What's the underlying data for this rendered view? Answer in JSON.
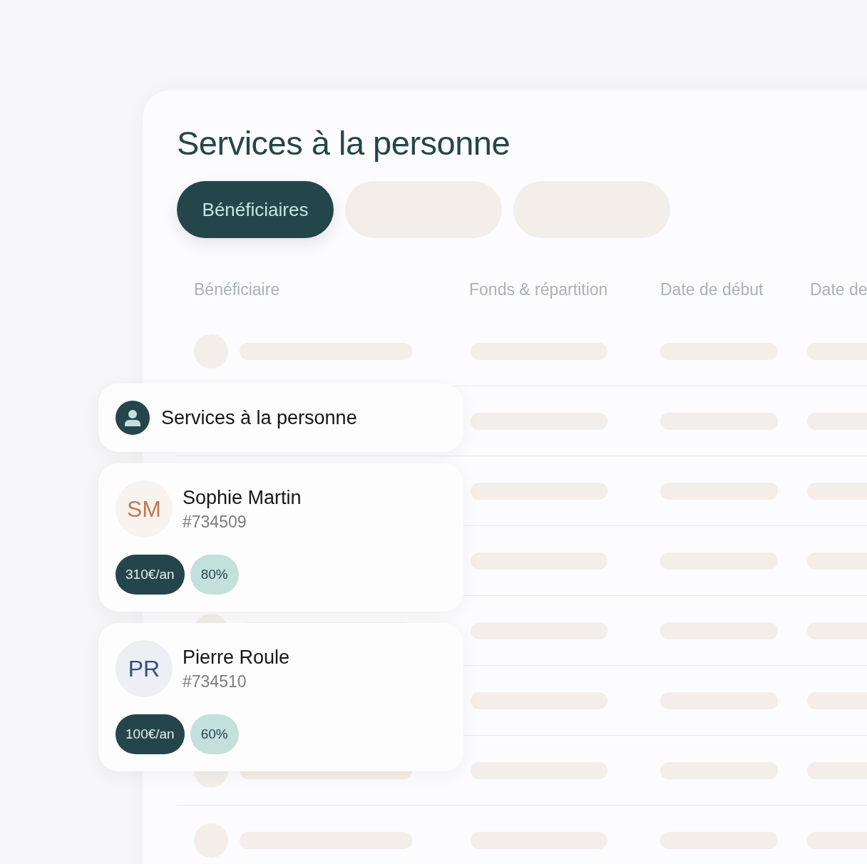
{
  "title": "Services à la personne",
  "tabs": [
    {
      "label": "Bénéficiaires",
      "selected": true
    }
  ],
  "table": {
    "columns": [
      "Bénéficiaire",
      "Fonds & répartition",
      "Date de début",
      "Date de"
    ]
  },
  "overlay": {
    "header": "Services à la personne",
    "beneficiaries": [
      {
        "initials": "SM",
        "color": "#c07a50",
        "name": "Sophie Martin",
        "id": "#734509",
        "amount": "310€/an",
        "share": "80%"
      },
      {
        "initials": "PR",
        "color": "#2f4f80",
        "name": "Pierre Roule",
        "id": "#734510",
        "amount": "100€/an",
        "share": "60%"
      }
    ]
  }
}
